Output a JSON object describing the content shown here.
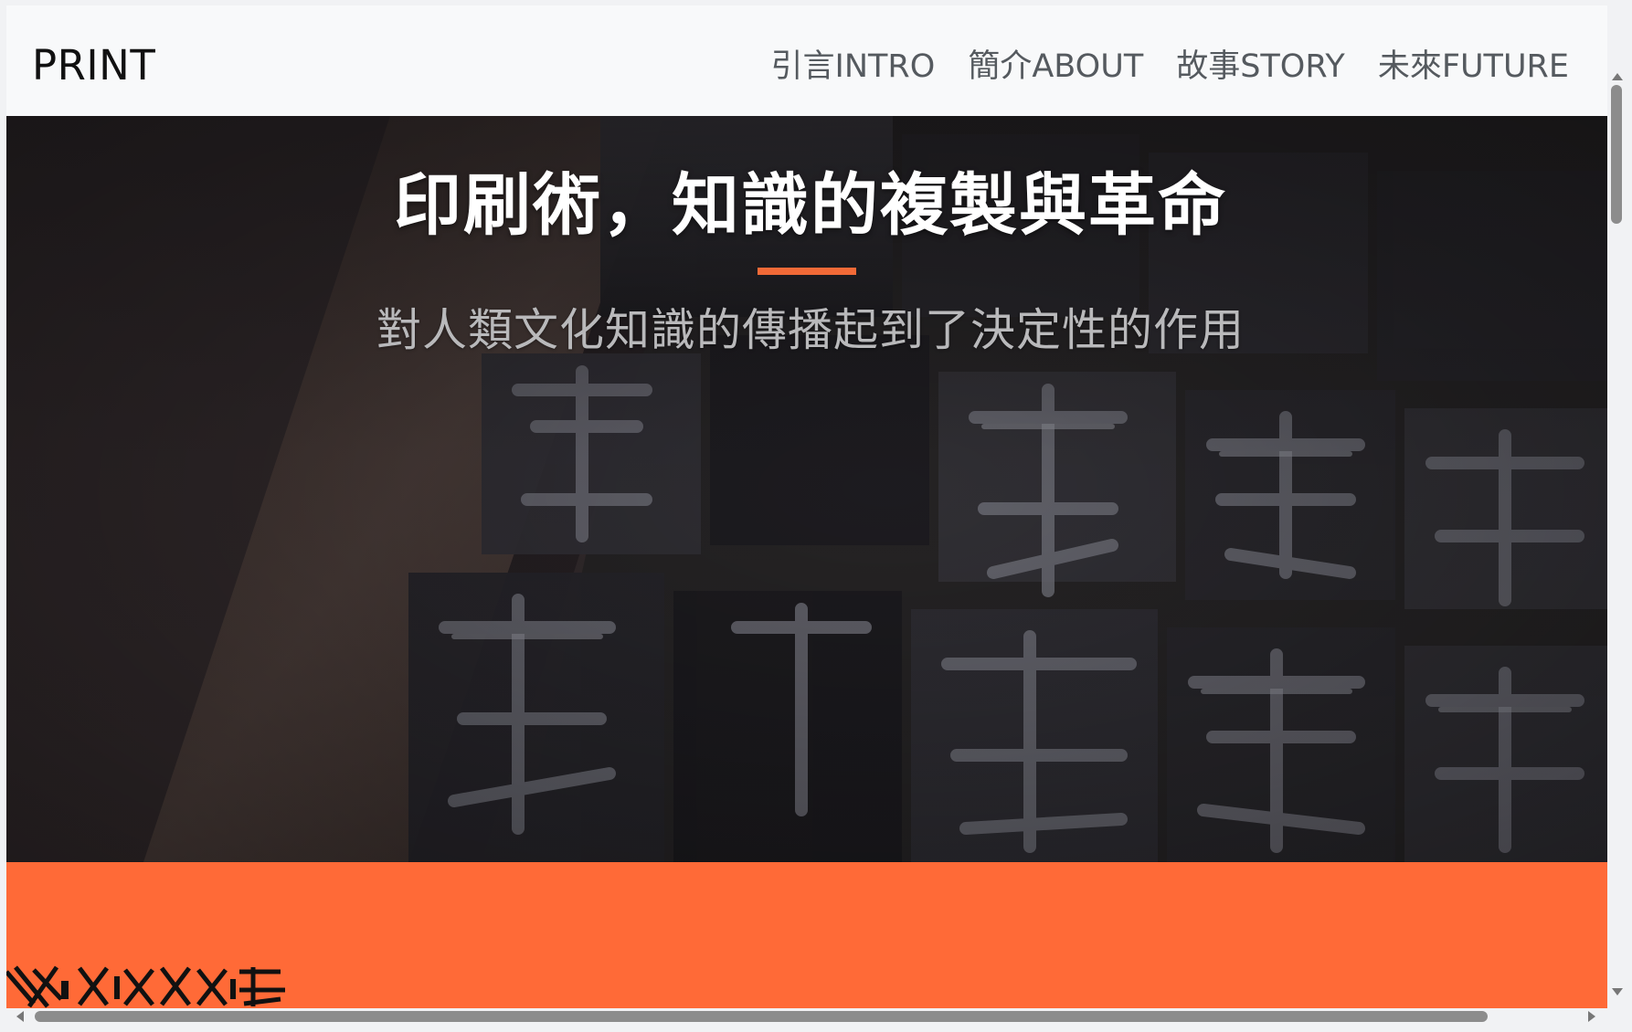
{
  "navbar": {
    "brand": "PRINT",
    "links": [
      {
        "label": "引言INTRO"
      },
      {
        "label": "簡介ABOUT"
      },
      {
        "label": "故事STORY"
      },
      {
        "label": "未來FUTURE"
      }
    ]
  },
  "hero": {
    "title": "印刷術，知識的複製與革命",
    "subtitle": "對人類文化知識的傳播起到了決定性的作用",
    "background_image": "movable-type-blocks-photo"
  },
  "colors": {
    "accent": "#ff6a37",
    "navbar_bg": "#f8f9fa",
    "nav_text": "#555a5f",
    "title_text": "#ffffff",
    "subtitle_text": "#b9b9bb"
  },
  "scrollbars": {
    "vertical_icon": "vertical-scrollbar",
    "horizontal_icon": "horizontal-scrollbar"
  }
}
